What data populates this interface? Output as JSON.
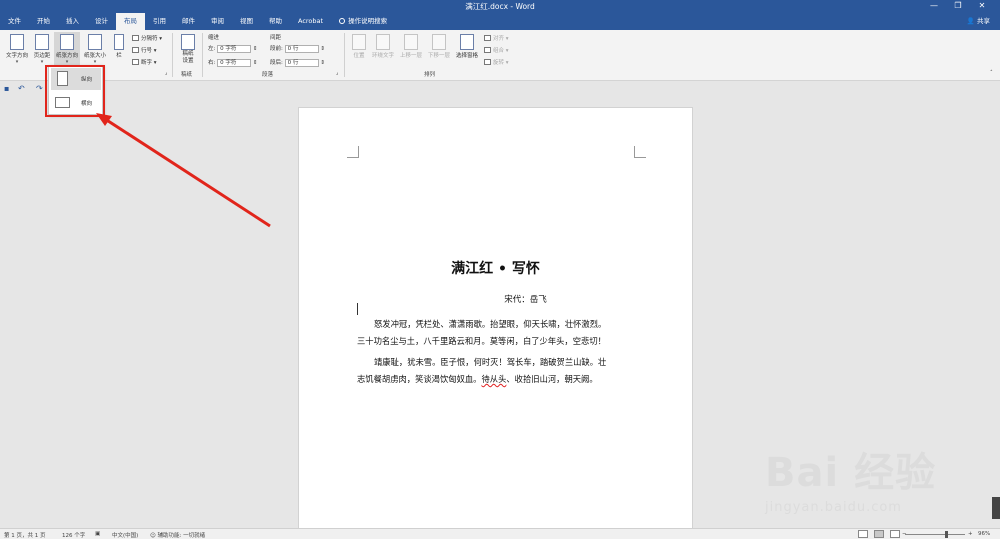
{
  "window": {
    "title": "满江红.docx  -  Word",
    "buttons": [
      "—",
      "❐",
      "✕"
    ]
  },
  "menu": {
    "tabs": [
      "文件",
      "开始",
      "插入",
      "设计",
      "布局",
      "引用",
      "邮件",
      "审阅",
      "视图",
      "帮助",
      "Acrobat",
      "操作说明搜索"
    ],
    "active_tab": "布局",
    "share": "共享"
  },
  "ribbon": {
    "page_setup": {
      "text_direction": "文字方向",
      "margins": "页边距",
      "orientation": "纸张方向",
      "size": "纸张大小",
      "columns": "栏",
      "breaks": "分隔符",
      "line_numbers": "行号",
      "hyphenation": "断字"
    },
    "draft": {
      "draft_settings": "稿纸\n设置",
      "group_label": "稿纸"
    },
    "paragraph": {
      "indent_label": "缩进",
      "spacing_label": "间距",
      "left_label": "左:",
      "left_value": "0 字符",
      "right_label": "右:",
      "right_value": "0 字符",
      "before_label": "段前:",
      "before_value": "0 行",
      "after_label": "段后:",
      "after_value": "0 行",
      "group_label": "段落"
    },
    "arrange": {
      "position": "位置",
      "wrap_text": "环绕文字",
      "bring_forward": "上移一层",
      "send_backward": "下移一层",
      "selection_pane": "选择窗格",
      "align": "对齐",
      "group": "组合",
      "rotate": "旋转",
      "group_label": "排列"
    }
  },
  "orientation_menu": {
    "portrait": "纵向",
    "landscape": "横向",
    "selected": "portrait"
  },
  "document": {
    "title": "满江红 • 写怀",
    "author": "宋代：岳飞",
    "para1": [
      "怒发冲冠，凭栏处、潇潇雨歇。抬望眼，仰天长啸，壮怀激烈。",
      "三十功名尘与土，八千里路云和月。莫等闲，白了少年头，空悲切！"
    ],
    "para2_line1": "靖康耻，犹未雪。臣子恨，何时灭！驾长车，踏破贺兰山缺。壮",
    "para2_line2_a": "志饥餐胡虏肉，笑谈渴饮匈奴血。",
    "para2_line2_b": "待从头",
    "para2_line2_c": "、收拾旧山河，朝天阙。"
  },
  "watermark": {
    "line1": "Bai 经验",
    "line2": "jingyan.baidu.com"
  },
  "status": {
    "page": "第 1 页，共 1 页",
    "words": "126 个字",
    "language": "中文(中国)",
    "accessibility": "辅助功能: 一切就绪",
    "zoom": "96%"
  },
  "colors": {
    "brand": "#2b579a",
    "highlight": "#e1251b"
  }
}
